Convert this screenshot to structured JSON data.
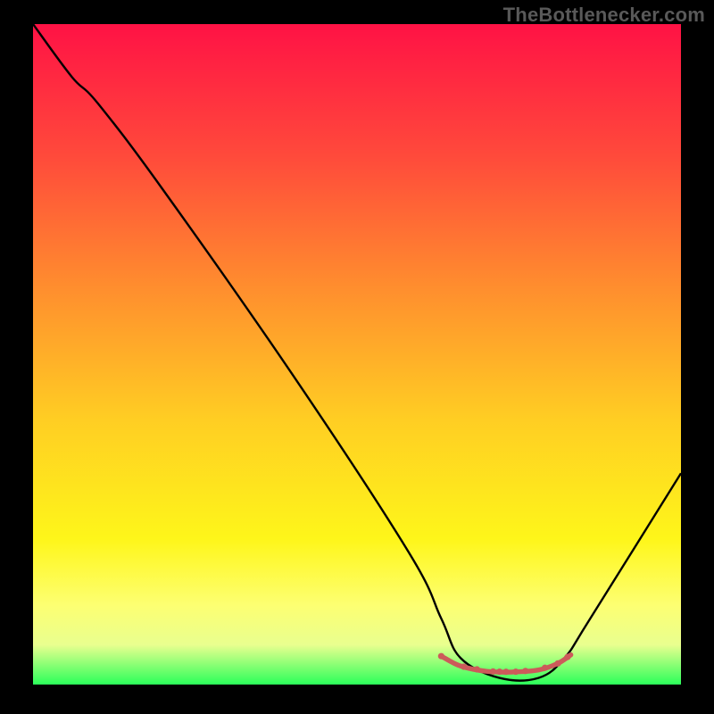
{
  "watermark": "TheBottlenecker.com",
  "chart_data": {
    "type": "line",
    "title": "",
    "xlabel": "",
    "ylabel": "",
    "xlim": [
      0,
      100
    ],
    "ylim": [
      0,
      100
    ],
    "gradient_stops": [
      {
        "offset": 0,
        "color": "#ff1245"
      },
      {
        "offset": 20,
        "color": "#ff4a3b"
      },
      {
        "offset": 40,
        "color": "#ff8e2e"
      },
      {
        "offset": 60,
        "color": "#ffce23"
      },
      {
        "offset": 78,
        "color": "#fef61a"
      },
      {
        "offset": 88,
        "color": "#fdff72"
      },
      {
        "offset": 94,
        "color": "#e9ff8f"
      },
      {
        "offset": 100,
        "color": "#2bff5a"
      }
    ],
    "series": [
      {
        "name": "curve",
        "stroke": "#000000",
        "x": [
          0,
          6,
          10,
          20,
          40,
          58,
          63,
          66,
          72,
          78,
          82,
          86,
          100
        ],
        "y": [
          100,
          92,
          88,
          75,
          47,
          20,
          10,
          4,
          1,
          1,
          4,
          10,
          32
        ]
      },
      {
        "name": "low-band",
        "stroke": "#cc5a5a",
        "x": [
          63,
          66,
          70,
          74,
          78,
          81,
          83
        ],
        "y": [
          4.3,
          2.8,
          2.0,
          1.9,
          2.2,
          3.2,
          4.5
        ]
      }
    ],
    "low_band_markers_x": [
      63,
      66.5,
      68.5,
      71,
      72,
      73,
      74.5,
      76,
      79,
      81,
      82.5
    ]
  }
}
